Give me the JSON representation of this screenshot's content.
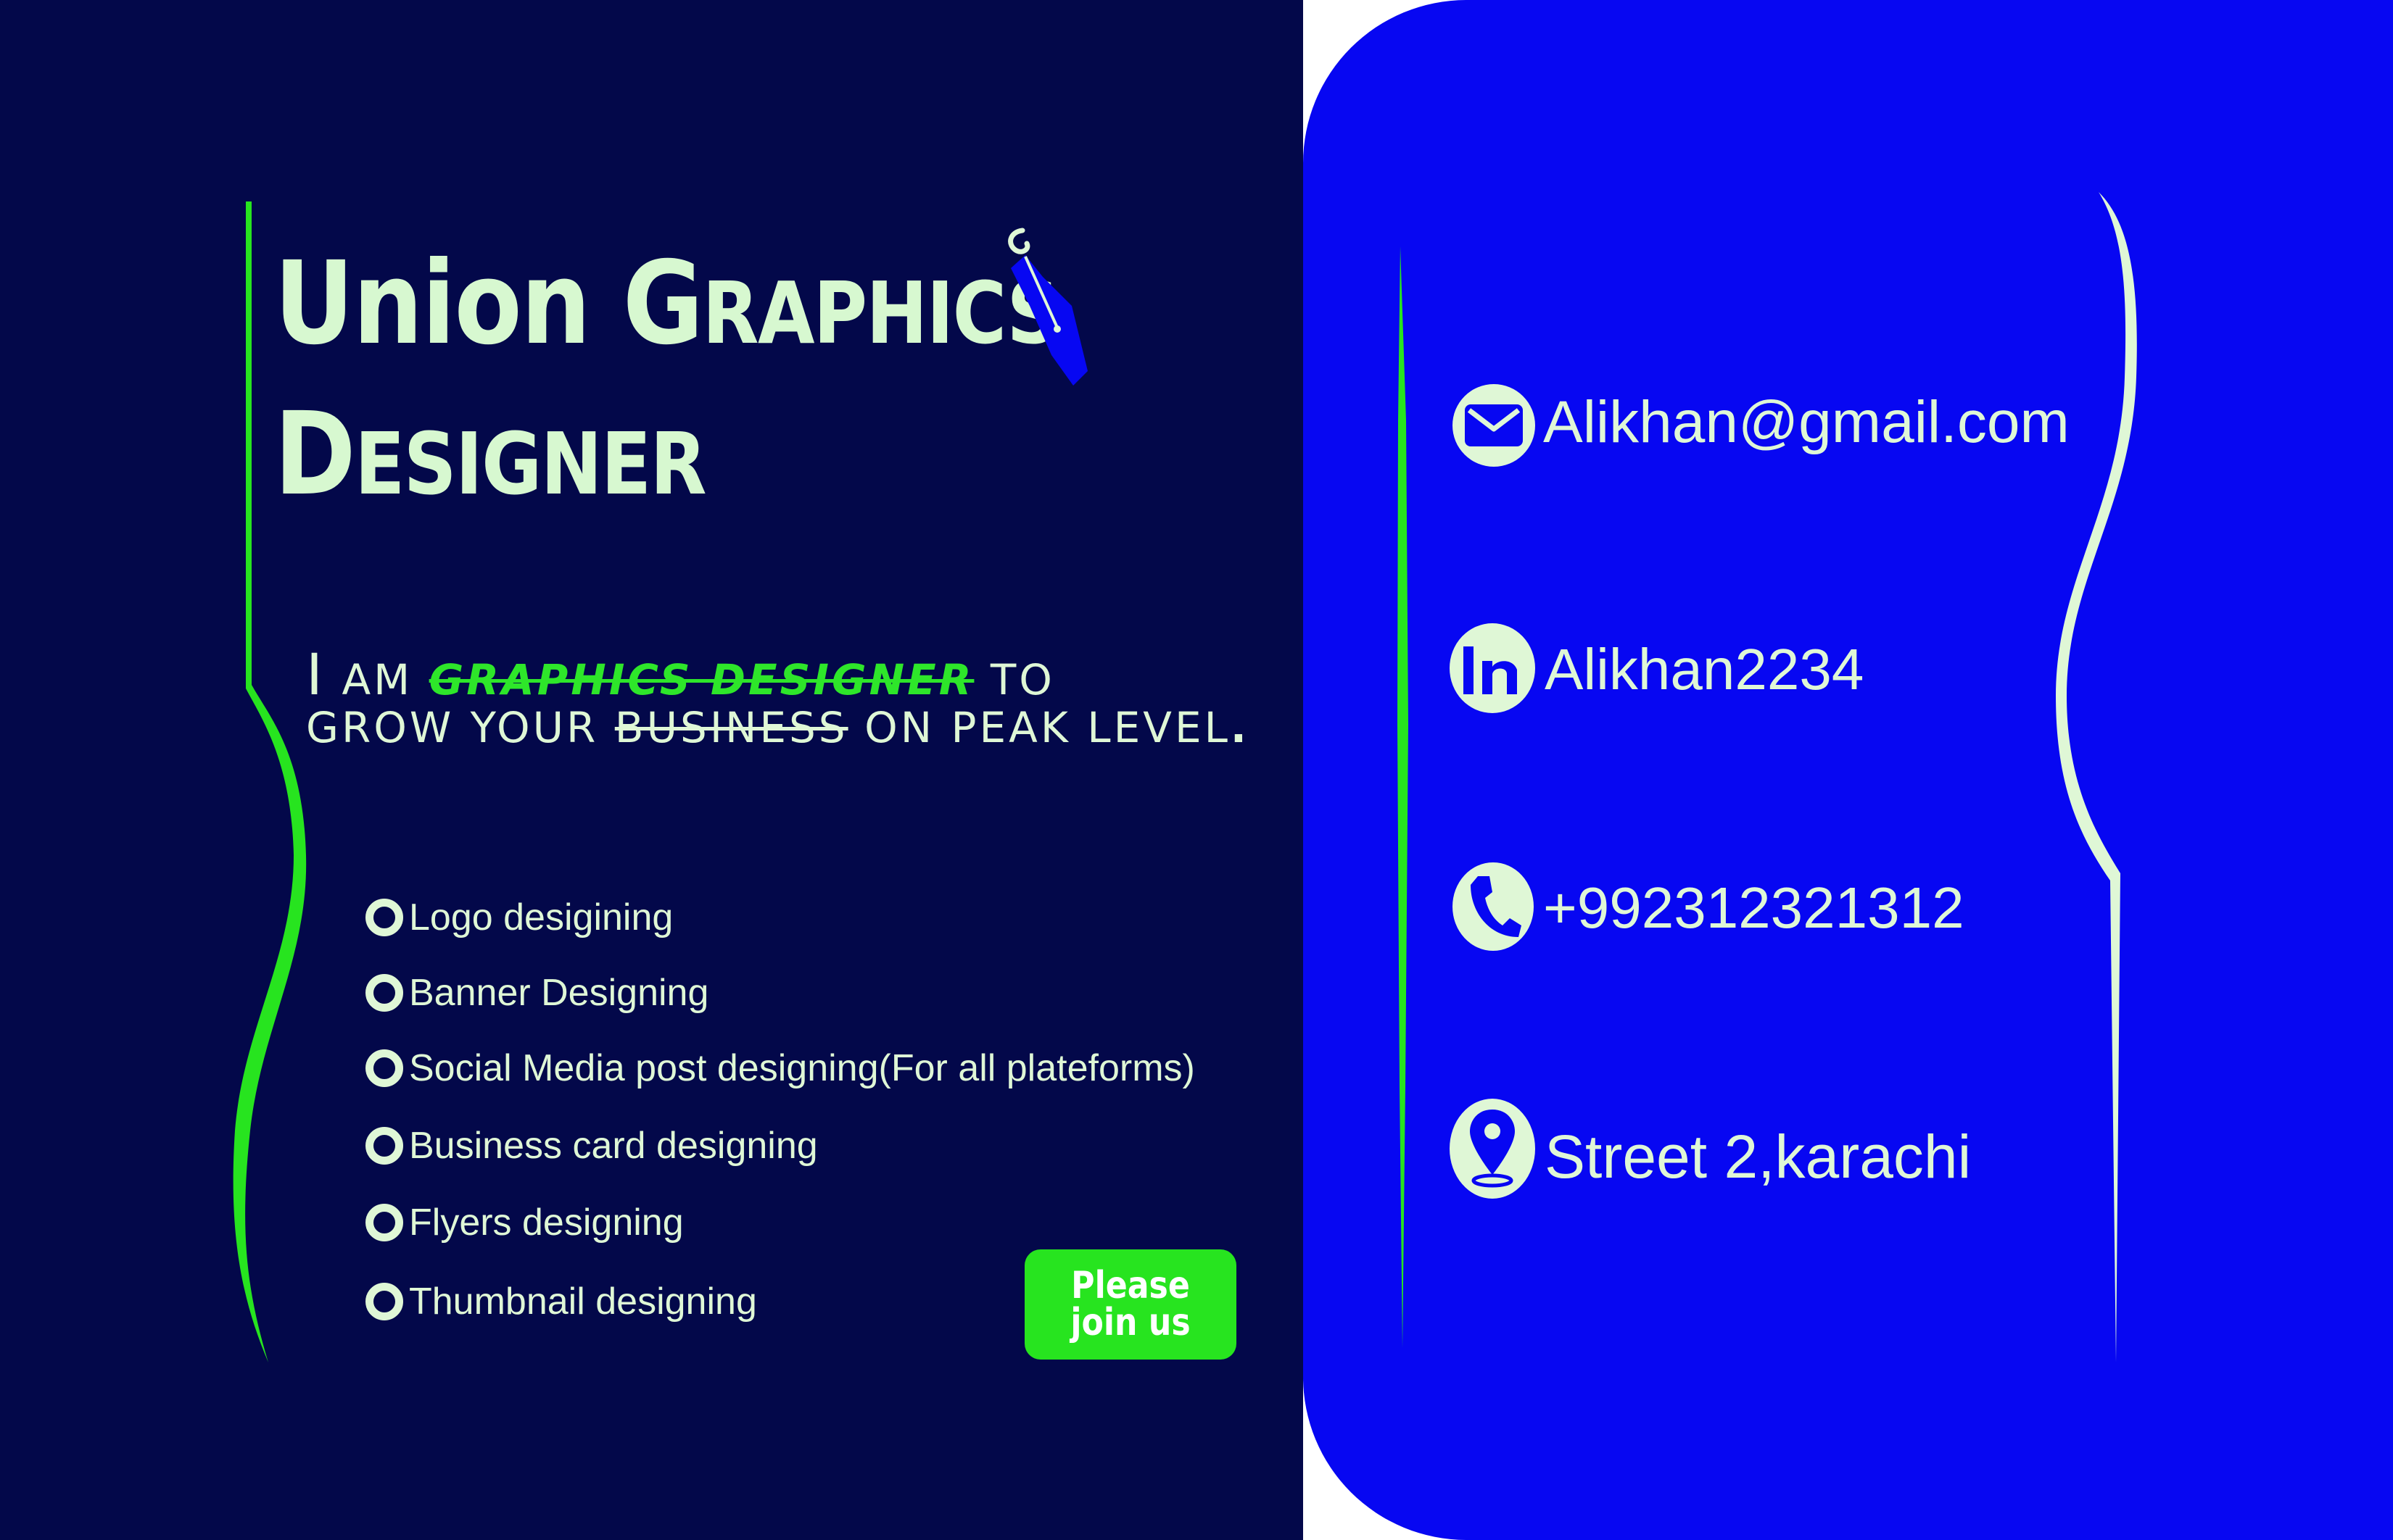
{
  "brand": {
    "title_word1": "Union",
    "title_word2_initial": "G",
    "title_word2_rest": "raphics",
    "title_line2_initial": "D",
    "title_line2_rest": "esigner",
    "pen_icon": "pen-nib-icon"
  },
  "tagline": {
    "line1_cap": "I",
    "line1_word": "am",
    "line1_highlight": "GRAPHICS DESIGNER",
    "line1_end": "to",
    "line2_start": "grow your",
    "line2_strike": "business",
    "line2_end": "on peak level",
    "line2_period": "."
  },
  "services": [
    "Logo desigining",
    "Banner Designing",
    "Social Media post designing(For all plateforms)",
    "Business card designing",
    "Flyers designing",
    "Thumbnail designing"
  ],
  "join_button": {
    "label": "Please join us"
  },
  "contacts": {
    "email": {
      "icon": "envelope-icon",
      "value": "Alikhan@gmail.com"
    },
    "linkedin": {
      "icon": "linkedin-icon",
      "value": "Alikhan2234"
    },
    "phone": {
      "icon": "phone-icon",
      "value": "+992312321312"
    },
    "address": {
      "icon": "location-pin-icon",
      "value": "Street 2,karachi"
    }
  },
  "colors": {
    "left_background": "#03084a",
    "right_background": "#0707f2",
    "text_light": "#dff7d6",
    "accent_green": "#27e41f"
  }
}
